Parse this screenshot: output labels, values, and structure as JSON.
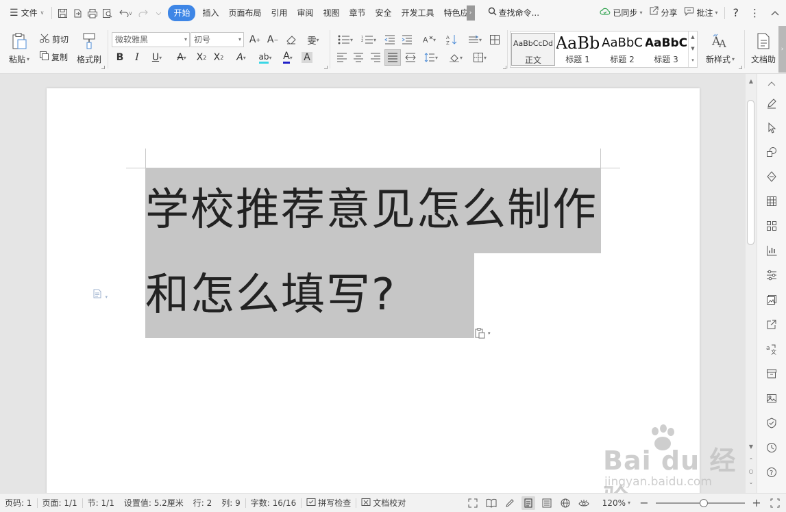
{
  "menubar": {
    "file_label": "文件",
    "tabs": [
      {
        "label": "开始",
        "active": true
      },
      {
        "label": "插入"
      },
      {
        "label": "页面布局"
      },
      {
        "label": "引用"
      },
      {
        "label": "审阅"
      },
      {
        "label": "视图"
      },
      {
        "label": "章节"
      },
      {
        "label": "安全"
      },
      {
        "label": "开发工具"
      },
      {
        "label": "特色应"
      }
    ],
    "search_label": "查找命令...",
    "sync_label": "已同步",
    "share_label": "分享",
    "comment_label": "批注",
    "help_label": "?",
    "accent_color": "#3e86e6"
  },
  "ribbon": {
    "paste_label": "粘贴",
    "cut_label": "剪切",
    "copy_label": "复制",
    "format_painter_label": "格式刷",
    "font_name": "微软雅黑",
    "font_size": "初号",
    "styles": [
      {
        "sample": "AaBbCcDd",
        "label": "正文"
      },
      {
        "sample": "AaBb",
        "label": "标题 1"
      },
      {
        "sample": "AaBbC",
        "label": "标题 2"
      },
      {
        "sample": "AaBbC",
        "label": "标题 3"
      }
    ],
    "new_style_label": "新样式",
    "doc_assistant_label": "文档助"
  },
  "document": {
    "heading_text": "学校推荐意见怎么制作和怎么填写?",
    "selection_color": "#c6c6c6"
  },
  "statusbar": {
    "page_num": "页码: 1",
    "page_total": "页面: 1/1",
    "section": "节: 1/1",
    "setting": "设置值: 5.2厘米",
    "row": "行: 2",
    "col": "列: 9",
    "word_count": "字数: 16/16",
    "spell_check": "拼写检查",
    "doc_proof": "文档校对",
    "zoom": "120%"
  },
  "watermark": {
    "brand": "Bai du 经验",
    "url": "jingyan.baidu.com"
  }
}
